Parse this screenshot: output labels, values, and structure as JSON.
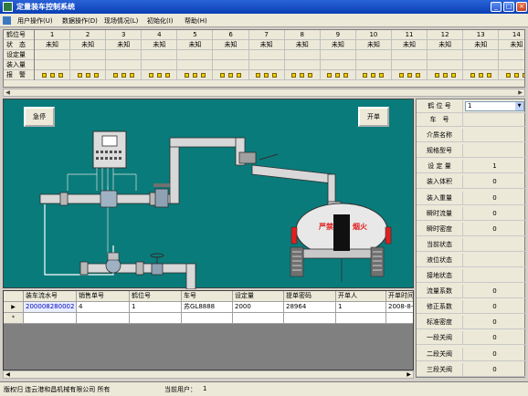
{
  "window": {
    "title": "定量装车控制系统",
    "buttons": [
      "_",
      "□",
      "×"
    ]
  },
  "menu": [
    {
      "label": "用户操作(U)"
    },
    {
      "label": "数据操作(D)"
    },
    {
      "label": "现场情况(L)"
    },
    {
      "label": "初始化(I)"
    },
    {
      "label": "帮助(H)"
    }
  ],
  "bay_grid": {
    "row_labels": [
      "鹤位号",
      "状　态",
      "设定量",
      "装入量",
      "报　警"
    ],
    "bays": [
      "1",
      "2",
      "3",
      "4",
      "5",
      "6",
      "7",
      "8",
      "9",
      "10",
      "11",
      "12",
      "13",
      "14"
    ],
    "status": [
      "未知",
      "未知",
      "未知",
      "未知",
      "未知",
      "未知",
      "未知",
      "未知",
      "未知",
      "未知",
      "未知",
      "未知",
      "未知",
      "未知"
    ]
  },
  "scene": {
    "stop_button": "急停",
    "start_button": "开单",
    "truck_left_sign": "严禁",
    "truck_right_sign": "烟火",
    "colors": {
      "background": "#0a7b7b",
      "pipe": "#d8d8d8",
      "truck_red": "#e02020"
    }
  },
  "props": {
    "bay_label": "鹤 位 号",
    "bay_value": "1",
    "rows": [
      {
        "label": "车　号",
        "value": ""
      },
      {
        "label": "介质名称",
        "value": ""
      },
      {
        "label": "规格型号",
        "value": ""
      },
      {
        "label": "设 定 量",
        "value": "1"
      },
      {
        "label": "装入体积",
        "value": "0"
      },
      {
        "label": "装入重量",
        "value": "0"
      },
      {
        "label": "瞬时流量",
        "value": "0"
      },
      {
        "label": "瞬时密度",
        "value": "0"
      },
      {
        "label": "当前状态",
        "value": ""
      },
      {
        "label": "液位状态",
        "value": ""
      },
      {
        "label": "接地状态",
        "value": ""
      },
      {
        "label": "流量系数",
        "value": "0"
      },
      {
        "label": "修正系数",
        "value": "0"
      },
      {
        "label": "标准密度",
        "value": "0"
      },
      {
        "label": "一段关阀",
        "value": "0"
      },
      {
        "label": "二段关阀",
        "value": "0"
      },
      {
        "label": "三段关阀",
        "value": "0"
      }
    ]
  },
  "table": {
    "columns": [
      "装车流水号",
      "销售单号",
      "鹤位号",
      "车号",
      "设定量",
      "提单密码",
      "开单人",
      "开单时间"
    ],
    "rows": [
      [
        "200008280002",
        "4",
        "1",
        "苏GL8888",
        "2000",
        "28964",
        "1",
        "2008-8-28"
      ]
    ],
    "row_markers": [
      "▶",
      "*"
    ]
  },
  "status": {
    "copyright": "版权归 连云港和昌机械有限公司 所有",
    "user_label": "当前用户：",
    "user_value": "1"
  }
}
